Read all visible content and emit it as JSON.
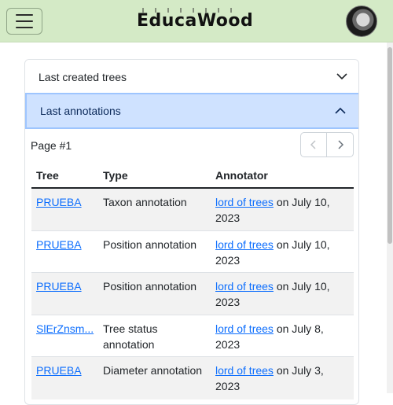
{
  "navbar": {
    "brand": "EducaWood",
    "menu_icon": "hamburger-icon",
    "avatar_icon": "user-avatar",
    "background": "#d4eac6"
  },
  "accordion": {
    "section1_label": "Last created trees",
    "section1_icon": "chevron-down-icon",
    "section2_label": "Last annotations",
    "section2_icon": "chevron-up-icon",
    "active_color": "#cfe2ff"
  },
  "pagination": {
    "page_label": "Page #1",
    "prev_icon": "chevron-left-icon",
    "next_icon": "chevron-right-icon"
  },
  "table": {
    "headers": [
      "Tree",
      "Type",
      "Annotator"
    ],
    "rows": [
      {
        "tree": "PRUEBA",
        "type": "Taxon annotation",
        "type2": "",
        "annotator": "lord of trees",
        "date": " on July 10,",
        "date2": "2023"
      },
      {
        "tree": "PRUEBA",
        "type": "Position annotation",
        "type2": "",
        "annotator": "lord of trees",
        "date": " on July 10,",
        "date2": "2023"
      },
      {
        "tree": "PRUEBA",
        "type": "Position annotation",
        "type2": "",
        "annotator": "lord of trees",
        "date": " on July 10,",
        "date2": "2023"
      },
      {
        "tree": "SlErZnsm...",
        "type": "Tree status",
        "type2": "annotation",
        "annotator": "lord of trees",
        "date": " on July 8,",
        "date2": "2023"
      },
      {
        "tree": "PRUEBA",
        "type": "Diameter annotation",
        "type2": "",
        "annotator": "lord of trees",
        "date": " on July 3,",
        "date2": "2023"
      }
    ]
  }
}
